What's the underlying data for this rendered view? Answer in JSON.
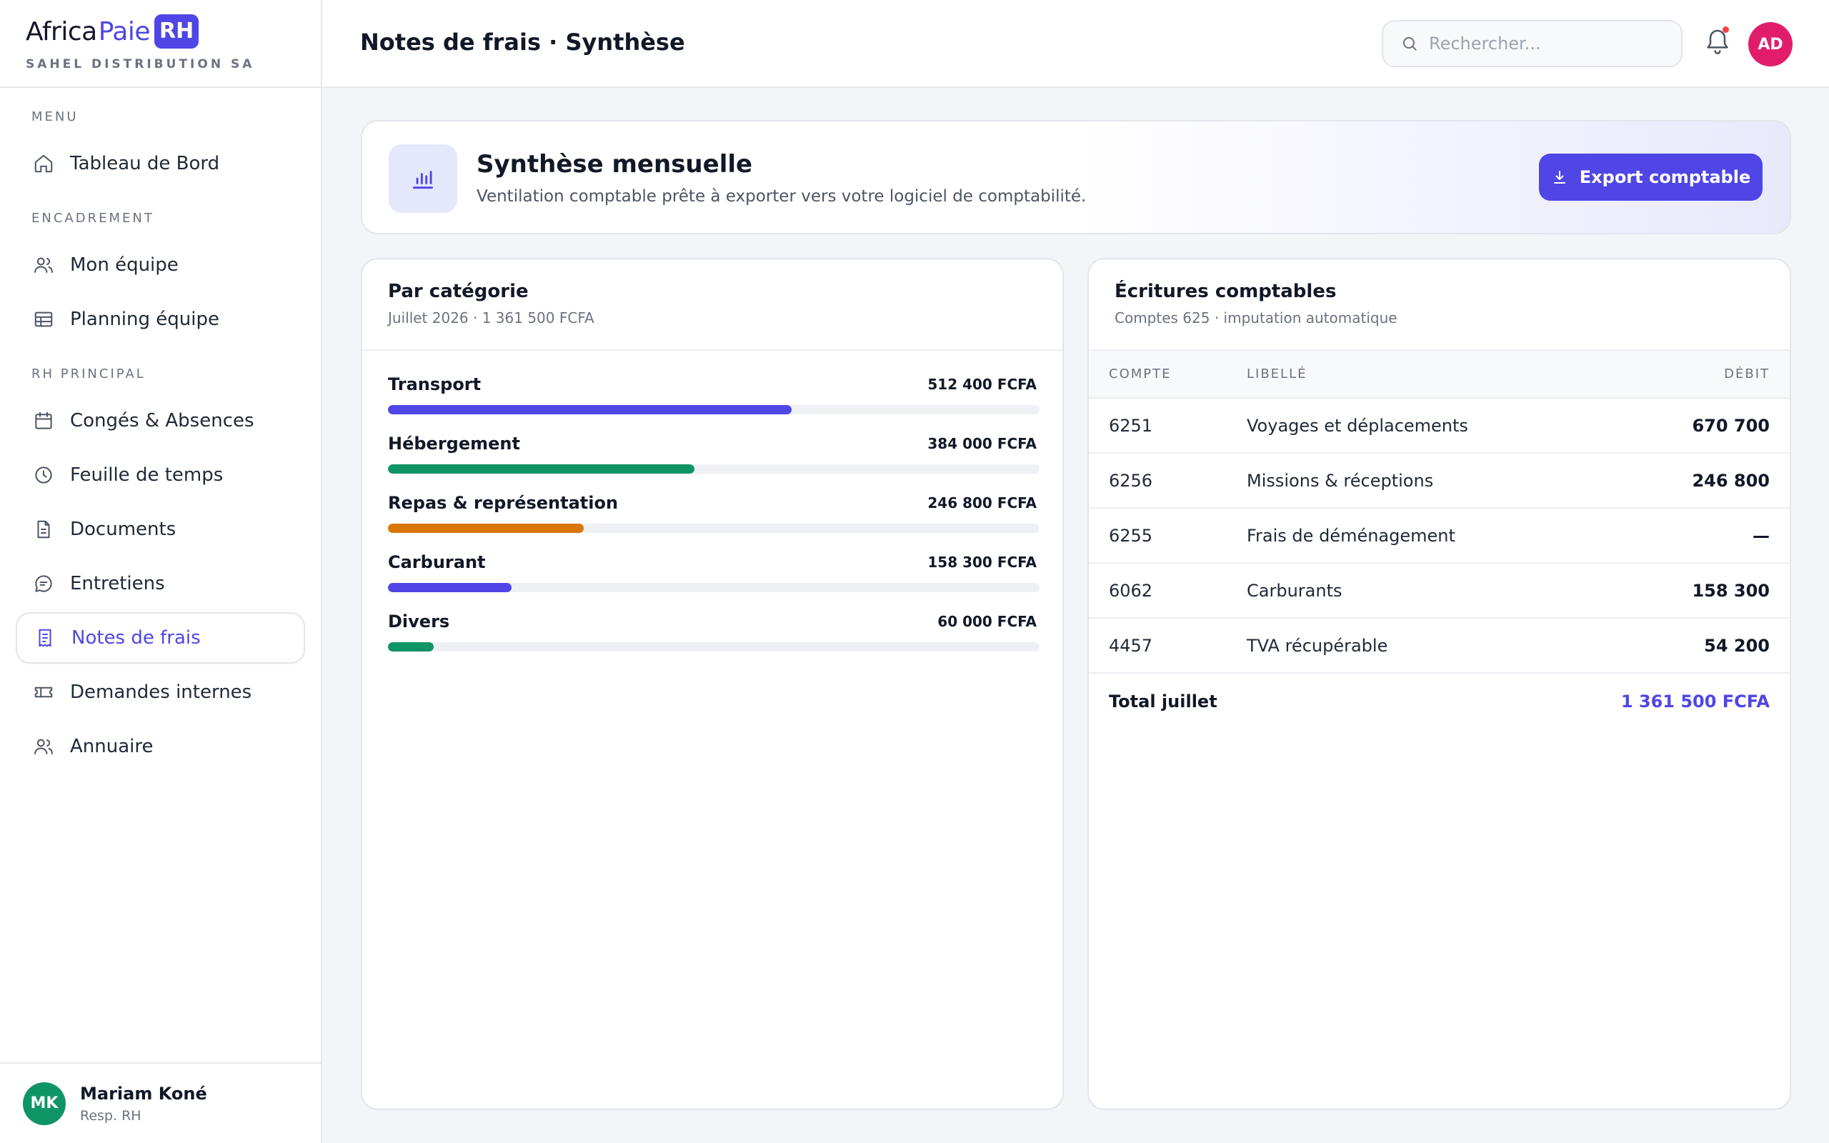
{
  "brand": {
    "name_part1": "Africa",
    "name_part2": "Paie",
    "badge": "RH",
    "company": "SAHEL DISTRIBUTION SA"
  },
  "sidebar": {
    "sections": [
      "MENU",
      "ENCADREMENT",
      "RH PRINCIPAL"
    ],
    "items": [
      {
        "label": "Tableau de Bord",
        "icon": "home-icon"
      },
      {
        "label": "Mon équipe",
        "icon": "users-icon"
      },
      {
        "label": "Planning équipe",
        "icon": "table-grid-icon"
      },
      {
        "label": "Congés & Absences",
        "icon": "calendar-icon"
      },
      {
        "label": "Feuille de temps",
        "icon": "clock-icon"
      },
      {
        "label": "Documents",
        "icon": "document-icon"
      },
      {
        "label": "Entretiens",
        "icon": "chat-bubble-icon"
      },
      {
        "label": "Notes de frais",
        "icon": "receipt-icon",
        "active": true
      },
      {
        "label": "Demandes internes",
        "icon": "ticket-icon"
      },
      {
        "label": "Annuaire",
        "icon": "contacts-icon"
      }
    ],
    "user": {
      "initials": "MK",
      "name": "Mariam Koné",
      "role": "Resp. RH"
    }
  },
  "header": {
    "title": "Notes de frais · Synthèse",
    "search_placeholder": "Rechercher...",
    "avatar_initials": "AD"
  },
  "banner": {
    "title": "Synthèse mensuelle",
    "subtitle": "Ventilation comptable prête à exporter vers votre logiciel de comptabilité.",
    "export_label": "Export comptable"
  },
  "categories_card": {
    "title": "Par catégorie",
    "subtitle": "Juillet 2026 · 1 361 500 FCFA",
    "items": [
      {
        "name": "Transport",
        "amount": "512 400 FCFA",
        "fraction": 0.62,
        "color": "#4f46e5"
      },
      {
        "name": "Hébergement",
        "amount": "384 000 FCFA",
        "fraction": 0.47,
        "color": "#0f9466"
      },
      {
        "name": "Repas & représentation",
        "amount": "246 800 FCFA",
        "fraction": 0.3,
        "color": "#d97706"
      },
      {
        "name": "Carburant",
        "amount": "158 300 FCFA",
        "fraction": 0.19,
        "color": "#4f46e5"
      },
      {
        "name": "Divers",
        "amount": "60 000 FCFA",
        "fraction": 0.07,
        "color": "#0f9466"
      }
    ]
  },
  "entries_card": {
    "title": "Écritures comptables",
    "subtitle": "Comptes 625 · imputation automatique",
    "columns": [
      "COMPTE",
      "LIBELLÉ",
      "DÉBIT"
    ],
    "rows": [
      {
        "account": "6251",
        "label": "Voyages et déplacements",
        "debit": "670 700"
      },
      {
        "account": "6256",
        "label": "Missions & réceptions",
        "debit": "246 800"
      },
      {
        "account": "6255",
        "label": "Frais de déménagement",
        "debit": "—"
      },
      {
        "account": "6062",
        "label": "Carburants",
        "debit": "158 300"
      },
      {
        "account": "4457",
        "label": "TVA récupérable",
        "debit": "54 200"
      }
    ],
    "total_label": "Total juillet",
    "total_value": "1 361 500 FCFA"
  },
  "colors": {
    "accent": "#4f46e5",
    "green": "#0f9466",
    "orange": "#d97706",
    "alert": "#ef4444"
  }
}
